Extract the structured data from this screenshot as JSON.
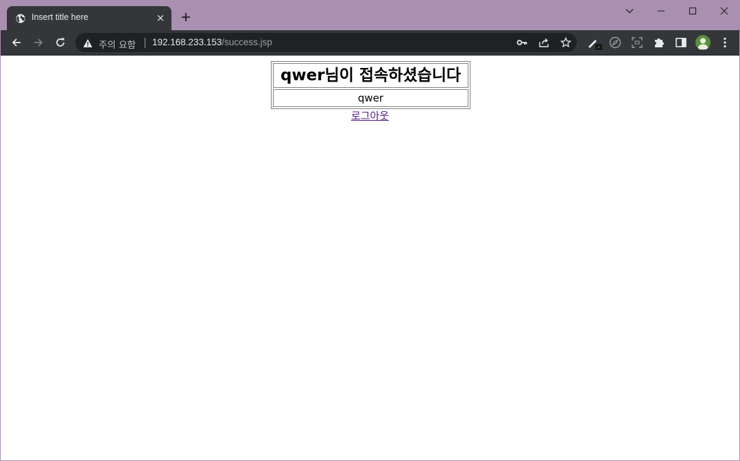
{
  "browser": {
    "tab": {
      "title": "Insert title here",
      "close_glyph": "×",
      "favicon": "globe-icon"
    },
    "address_bar": {
      "security_warning": "주의 요함",
      "url_host": "192.168.233.153",
      "url_path": "/success.jsp"
    },
    "colors": {
      "frame": "#a98fb0",
      "toolbar": "#35363a",
      "omnibox": "#202124",
      "visited_link": "#551a8b"
    }
  },
  "page": {
    "welcome_heading": "qwer님이 접속하셨습니다",
    "user_id": "qwer",
    "logout_link": "로그아웃"
  }
}
